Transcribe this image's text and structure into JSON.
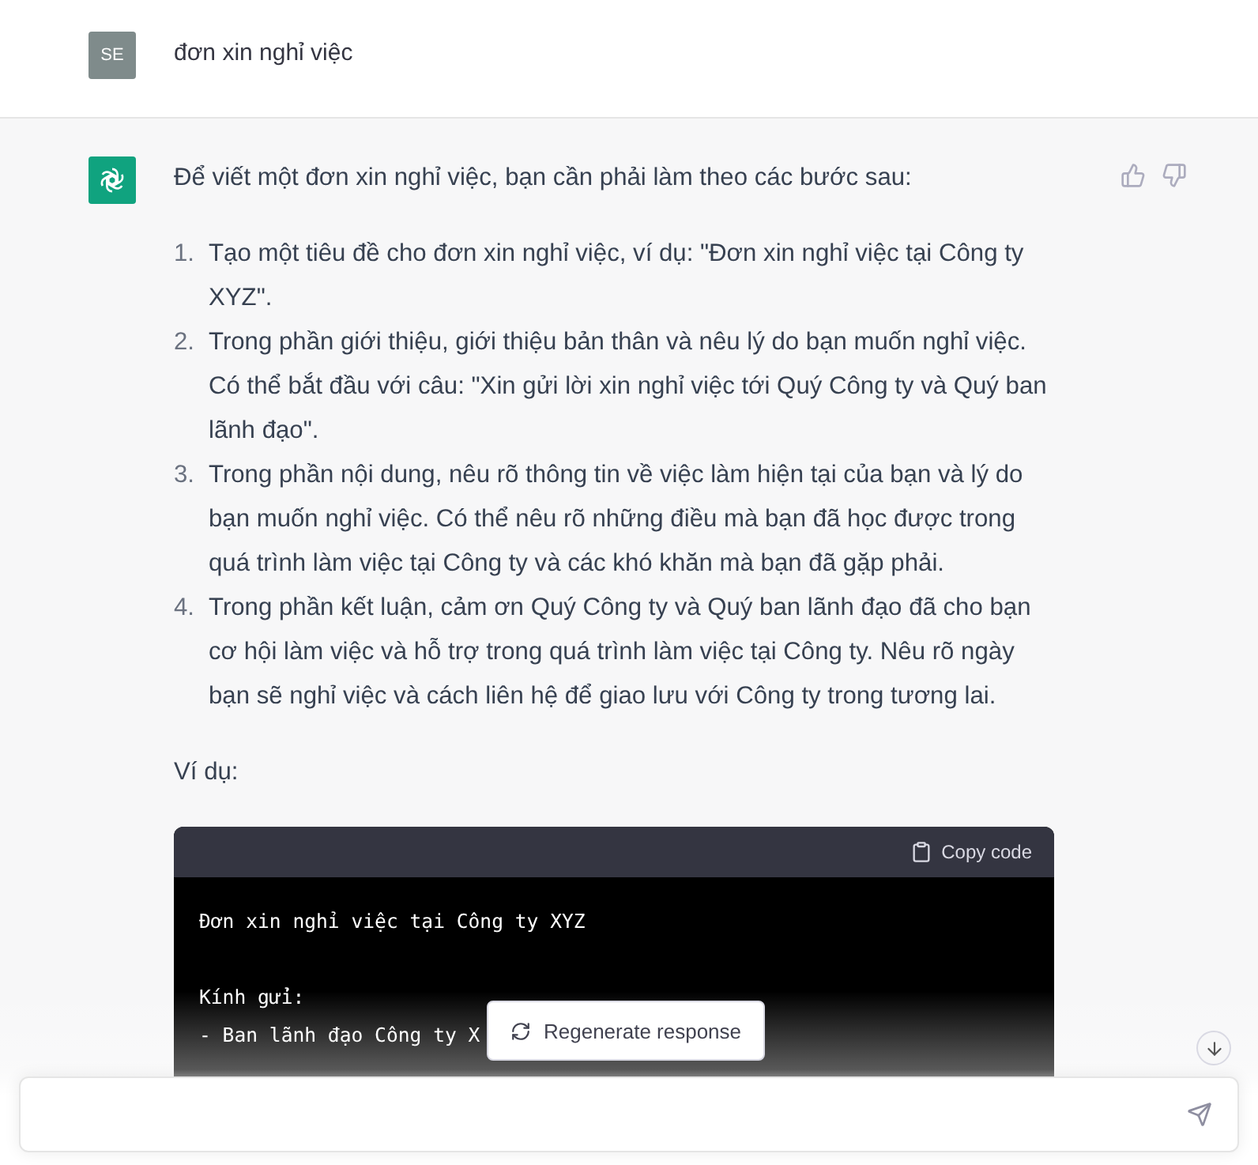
{
  "user_message": {
    "avatar": "SE",
    "text": "đơn xin nghỉ việc"
  },
  "assistant_message": {
    "intro": "Để viết một đơn xin nghỉ việc, bạn cần phải làm theo các bước sau:",
    "steps": [
      {
        "number": "1.",
        "text": "Tạo một tiêu đề cho đơn xin nghỉ việc, ví dụ: \"Đơn xin nghỉ việc tại Công ty XYZ\"."
      },
      {
        "number": "2.",
        "text": "Trong phần giới thiệu, giới thiệu bản thân và nêu lý do bạn muốn nghỉ việc. Có thể bắt đầu với câu: \"Xin gửi lời xin nghỉ việc tới Quý Công ty và Quý ban lãnh đạo\"."
      },
      {
        "number": "3.",
        "text": "Trong phần nội dung, nêu rõ thông tin về việc làm hiện tại của bạn và lý do bạn muốn nghỉ việc. Có thể nêu rõ những điều mà bạn đã học được trong quá trình làm việc tại Công ty và các khó khăn mà bạn đã gặp phải."
      },
      {
        "number": "4.",
        "text": "Trong phần kết luận, cảm ơn Quý Công ty và Quý ban lãnh đạo đã cho bạn cơ hội làm việc và hỗ trợ trong quá trình làm việc tại Công ty. Nêu rõ ngày bạn sẽ nghỉ việc và cách liên hệ để giao lưu với Công ty trong tương lai."
      }
    ],
    "example_label": "Ví dụ:",
    "code_block": {
      "copy_label": "Copy code",
      "paragraphs": [
        [
          "Đơn xin nghỉ việc tại Công ty XYZ"
        ],
        [
          "Kính gửi:",
          "- Ban lãnh đạo Công ty X"
        ]
      ]
    }
  },
  "regenerate_button": "Regenerate response"
}
